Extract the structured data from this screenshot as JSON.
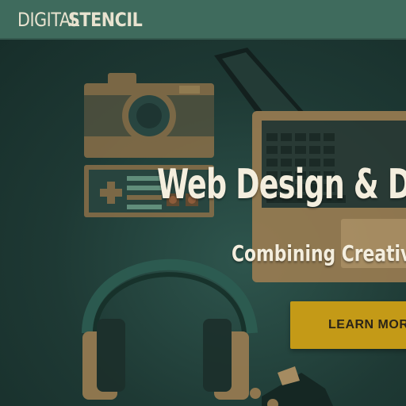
{
  "navbar": {
    "logo_light": "DIGITAL",
    "logo_bold": "STENCIL"
  },
  "hero": {
    "headline": "Web Design & D",
    "subhead": "Combining Creativit",
    "cta_label": "LEARN MOR"
  },
  "colors": {
    "navbar_bg": "#3f6b5d",
    "hero_bg": "#1e3934",
    "cta_bg": "#c49a17",
    "text_light": "#f4eede",
    "illustration_tan": "#9b7d52"
  },
  "illustration": {
    "items": [
      "camera-icon",
      "game-controller-icon",
      "laptop-icon",
      "headphones-icon",
      "guitar-icon"
    ]
  }
}
